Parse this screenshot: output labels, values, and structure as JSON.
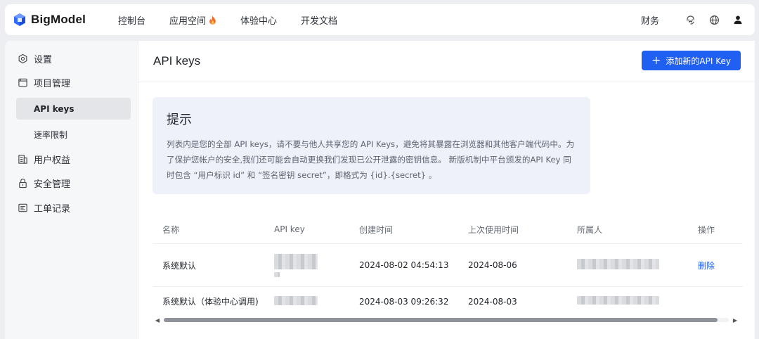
{
  "brand": {
    "name": "BigModel"
  },
  "nav": [
    {
      "label": "控制台"
    },
    {
      "label": "应用空间",
      "icon": "fire-icon"
    },
    {
      "label": "体验中心"
    },
    {
      "label": "开发文档"
    }
  ],
  "top_right": {
    "finance": "财务",
    "icons": [
      "support-icon",
      "globe-icon",
      "user-icon"
    ]
  },
  "sidebar": {
    "items": [
      {
        "label": "设置",
        "icon": "settings-icon"
      },
      {
        "label": "项目管理",
        "icon": "folder-icon"
      },
      {
        "label": "API keys",
        "active": true
      },
      {
        "label": "速率限制"
      },
      {
        "label": "用户权益",
        "icon": "benefits-icon"
      },
      {
        "label": "安全管理",
        "icon": "lock-icon"
      },
      {
        "label": "工单记录",
        "icon": "ticket-icon"
      }
    ]
  },
  "main": {
    "title": "API keys",
    "add_button": "添加新的API Key",
    "tip": {
      "title": "提示",
      "text": "列表内是您的全部 API keys，请不要与他人共享您的 API Keys，避免将其暴露在浏览器和其他客户端代码中。为了保护您帐户的安全,我们还可能会自动更换我们发现已公开泄露的密钥信息。 新版机制中平台颁发的API Key 同时包含 “用户标识 id” 和 “签名密钥 secret”，即格式为 {id}.{secret} 。"
    },
    "table": {
      "headers": {
        "name": "名称",
        "key": "API key",
        "created": "创建时间",
        "last_used": "上次使用时间",
        "owner": "所属人",
        "actions": "操作"
      },
      "rows": [
        {
          "name": "系统默认",
          "created": "2024-08-02 04:54:13",
          "last_used": "2024-08-06",
          "action": "删除"
        },
        {
          "name": "系统默认（体验中心调用)",
          "created": "2024-08-03 09:26:32",
          "last_used": "2024-08-03",
          "action": ""
        }
      ]
    },
    "scroll": {
      "position": 0.0,
      "visible_fraction": 0.98
    }
  },
  "colors": {
    "accent": "#1f5ff2",
    "brand_blue": "#2f6bff",
    "tip_bg": "#eef1f8"
  }
}
